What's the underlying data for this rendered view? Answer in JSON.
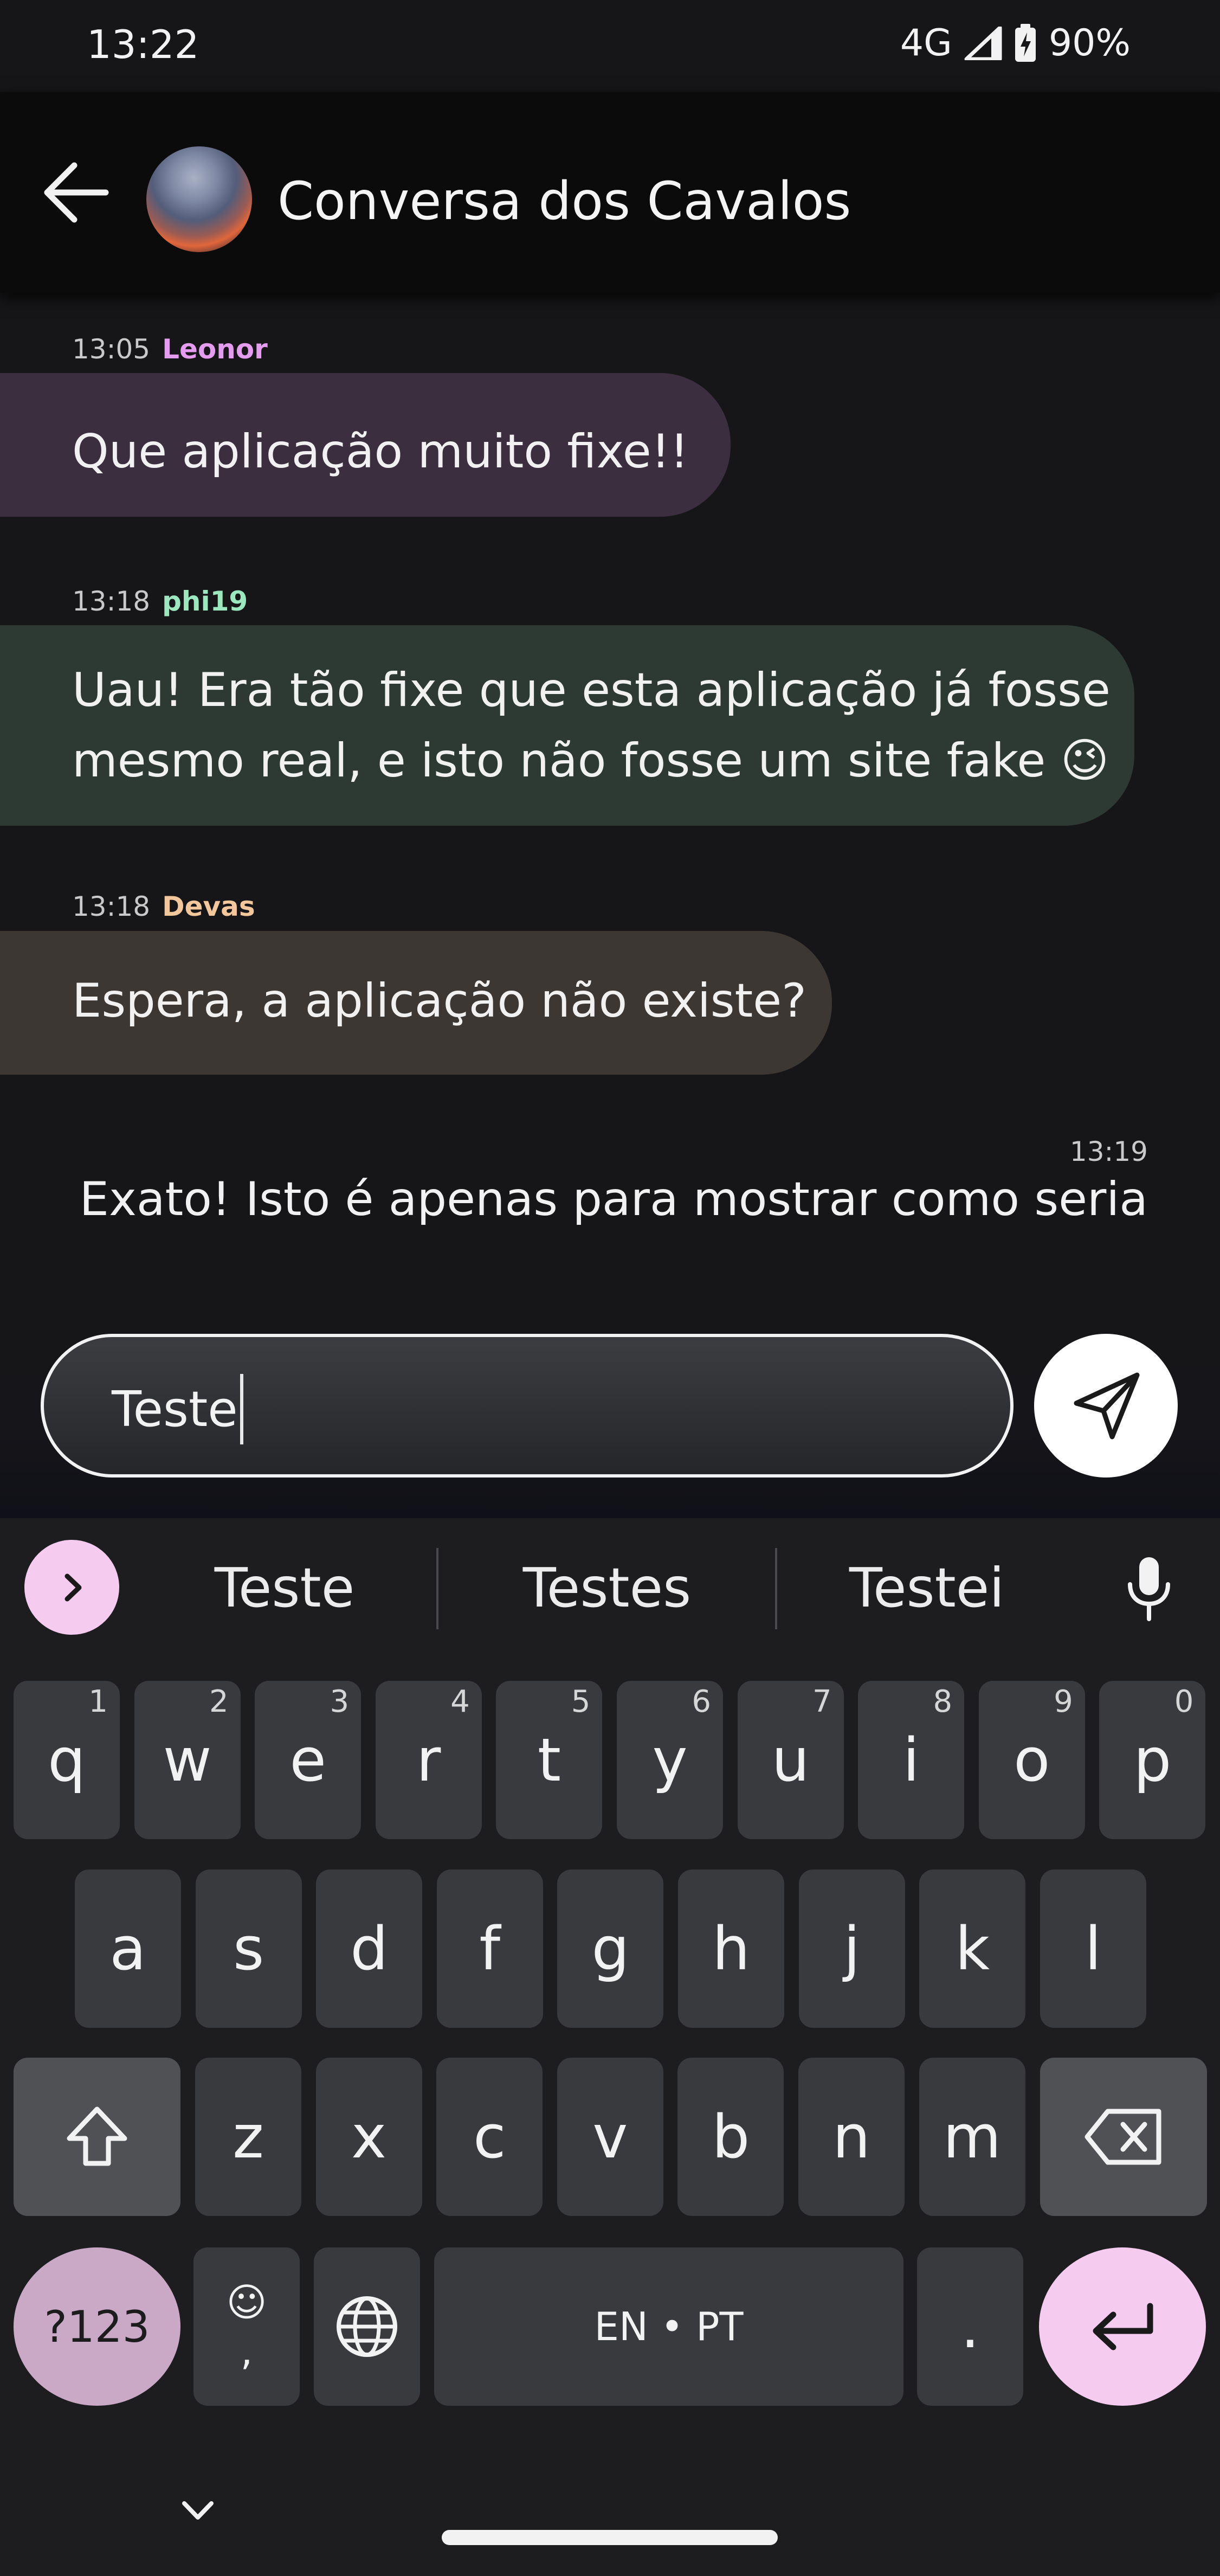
{
  "status_bar": {
    "time": "13:22",
    "network": "4G",
    "battery": "90%",
    "icons": [
      "signal-icon",
      "battery-charging-icon"
    ]
  },
  "header": {
    "title": "Conversa dos Cavalos",
    "back_icon": "arrow-left-icon",
    "avatar": "sunset-avatar"
  },
  "messages": [
    {
      "time": "13:05",
      "sender": "Leonor",
      "sender_color": "#e49cef",
      "bubble_color": "#3b2f3f",
      "lines": [
        "Que aplicação muito fixe!!"
      ]
    },
    {
      "time": "13:18",
      "sender": "phi19",
      "sender_color": "#9ce8be",
      "bubble_color": "#2c3a33",
      "lines": [
        "Uau! Era tão fixe que esta aplicação já fosse",
        "mesmo real, e isto não fosse um site fake 😉"
      ]
    },
    {
      "time": "13:18",
      "sender": "Devas",
      "sender_color": "#f2c79c",
      "bubble_color": "#3d3733",
      "lines": [
        "Espera, a aplicação não existe?"
      ]
    }
  ],
  "own_message": {
    "time": "13:19",
    "text": "Exato! Isto é apenas para mostrar como seria"
  },
  "composer": {
    "value": "Teste",
    "send_icon": "send-icon"
  },
  "keyboard": {
    "suggestions": [
      "Teste",
      "Testes",
      "Testei"
    ],
    "row1": [
      {
        "k": "q",
        "n": "1"
      },
      {
        "k": "w",
        "n": "2"
      },
      {
        "k": "e",
        "n": "3"
      },
      {
        "k": "r",
        "n": "4"
      },
      {
        "k": "t",
        "n": "5"
      },
      {
        "k": "y",
        "n": "6"
      },
      {
        "k": "u",
        "n": "7"
      },
      {
        "k": "i",
        "n": "8"
      },
      {
        "k": "o",
        "n": "9"
      },
      {
        "k": "p",
        "n": "0"
      }
    ],
    "row2": [
      "a",
      "s",
      "d",
      "f",
      "g",
      "h",
      "j",
      "k",
      "l"
    ],
    "row3": [
      "z",
      "x",
      "c",
      "v",
      "b",
      "n",
      "m"
    ],
    "symbols_label": "?123",
    "emoji_label": "☺",
    "comma_label": ",",
    "space_label": "EN • PT",
    "period_label": "."
  }
}
